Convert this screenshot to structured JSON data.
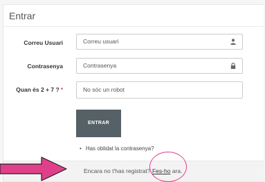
{
  "header": {
    "title": "Entrar"
  },
  "form": {
    "username": {
      "label": "Correu Usuari",
      "placeholder": "Correu usuari",
      "icon": "user-icon"
    },
    "password": {
      "label": "Contrasenya",
      "placeholder": "Contrasenya",
      "icon": "lock-icon"
    },
    "captcha": {
      "label": "Quan és 2 + 7 ?",
      "required_mark": "*",
      "placeholder": "No sóc un robot"
    },
    "submit_label": "ENTRAR",
    "forgot_bullet": "•",
    "forgot_label": "Has oblidat la contrasenya?"
  },
  "footer": {
    "text_before": "Encara no t'has registrat? ",
    "link_label": "Fes-ho",
    "text_after": " ara."
  },
  "colors": {
    "button": "#556166",
    "required": "#d9534f",
    "annotation": "#e0408a"
  }
}
